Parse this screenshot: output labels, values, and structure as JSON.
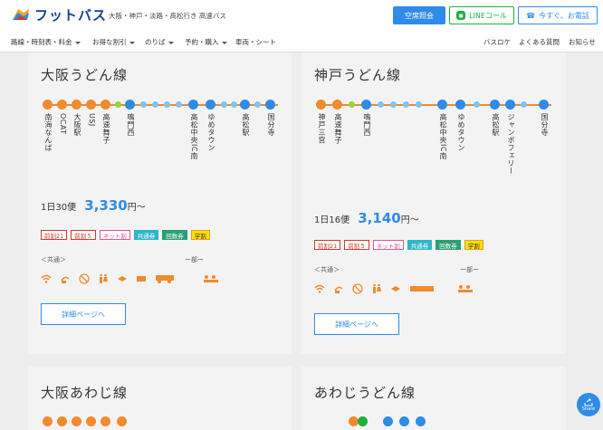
{
  "header": {
    "logo_text": "フットバス",
    "tagline": "大阪・神戸・淡路・高松行き 高速バス",
    "vacancy_button": "空席照会",
    "line_button": "LINEコール",
    "call_button": "今すぐ、お電話"
  },
  "nav": {
    "items": [
      "路線・時刻表・料金",
      "お得な割引",
      "のりば",
      "予約・購入",
      "車両・シート"
    ],
    "right_items": [
      "バスロケ",
      "よくある質問",
      "お知らせ"
    ]
  },
  "cards": [
    {
      "title": "大阪うどん線",
      "stops": [
        "南海なんば",
        "OCAT",
        "大阪駅",
        "USJ",
        "高速舞子",
        "",
        "鳴門西",
        "",
        "",
        "",
        "高松中央IC南",
        "ゆめタウン",
        "",
        "",
        "高松駅",
        "",
        "国分寺"
      ],
      "frequency": "1日30便",
      "price": "3,330",
      "price_suffix": "円〜",
      "badges": [
        "前割21",
        "前割５",
        "ネット割",
        "共通券",
        "回数券",
        "学割"
      ],
      "common_label": "＜共通＞",
      "partial_label": "ー部ー",
      "detail_button": "詳細ページへ"
    },
    {
      "title": "神戸うどん線",
      "stops": [
        "神戸三宮",
        "高速舞子",
        "鳴門西",
        "",
        "",
        "",
        "高松中央IC南",
        "ゆめタウン",
        "",
        "高松駅",
        "ジャンボフェリー",
        "",
        "国分寺"
      ],
      "frequency": "1日16便",
      "price": "3,140",
      "price_suffix": "円〜",
      "badges": [
        "前割21",
        "前割５",
        "ネット割",
        "共通券",
        "回数券",
        "学割"
      ],
      "common_label": "＜共通＞",
      "partial_label": "ー部ー",
      "detail_button": "詳細ページへ"
    },
    {
      "title": "大阪あわじ線"
    },
    {
      "title": "あわじうどん線"
    }
  ],
  "amenity_icons": [
    "wifi-icon",
    "outlet-icon",
    "no-smoking-icon",
    "toilet-icon",
    "blanket-icon",
    "seat-icon",
    "safety-brake-icon"
  ],
  "partial_icons": [
    "reservation-icon"
  ],
  "share_label": "Share"
}
